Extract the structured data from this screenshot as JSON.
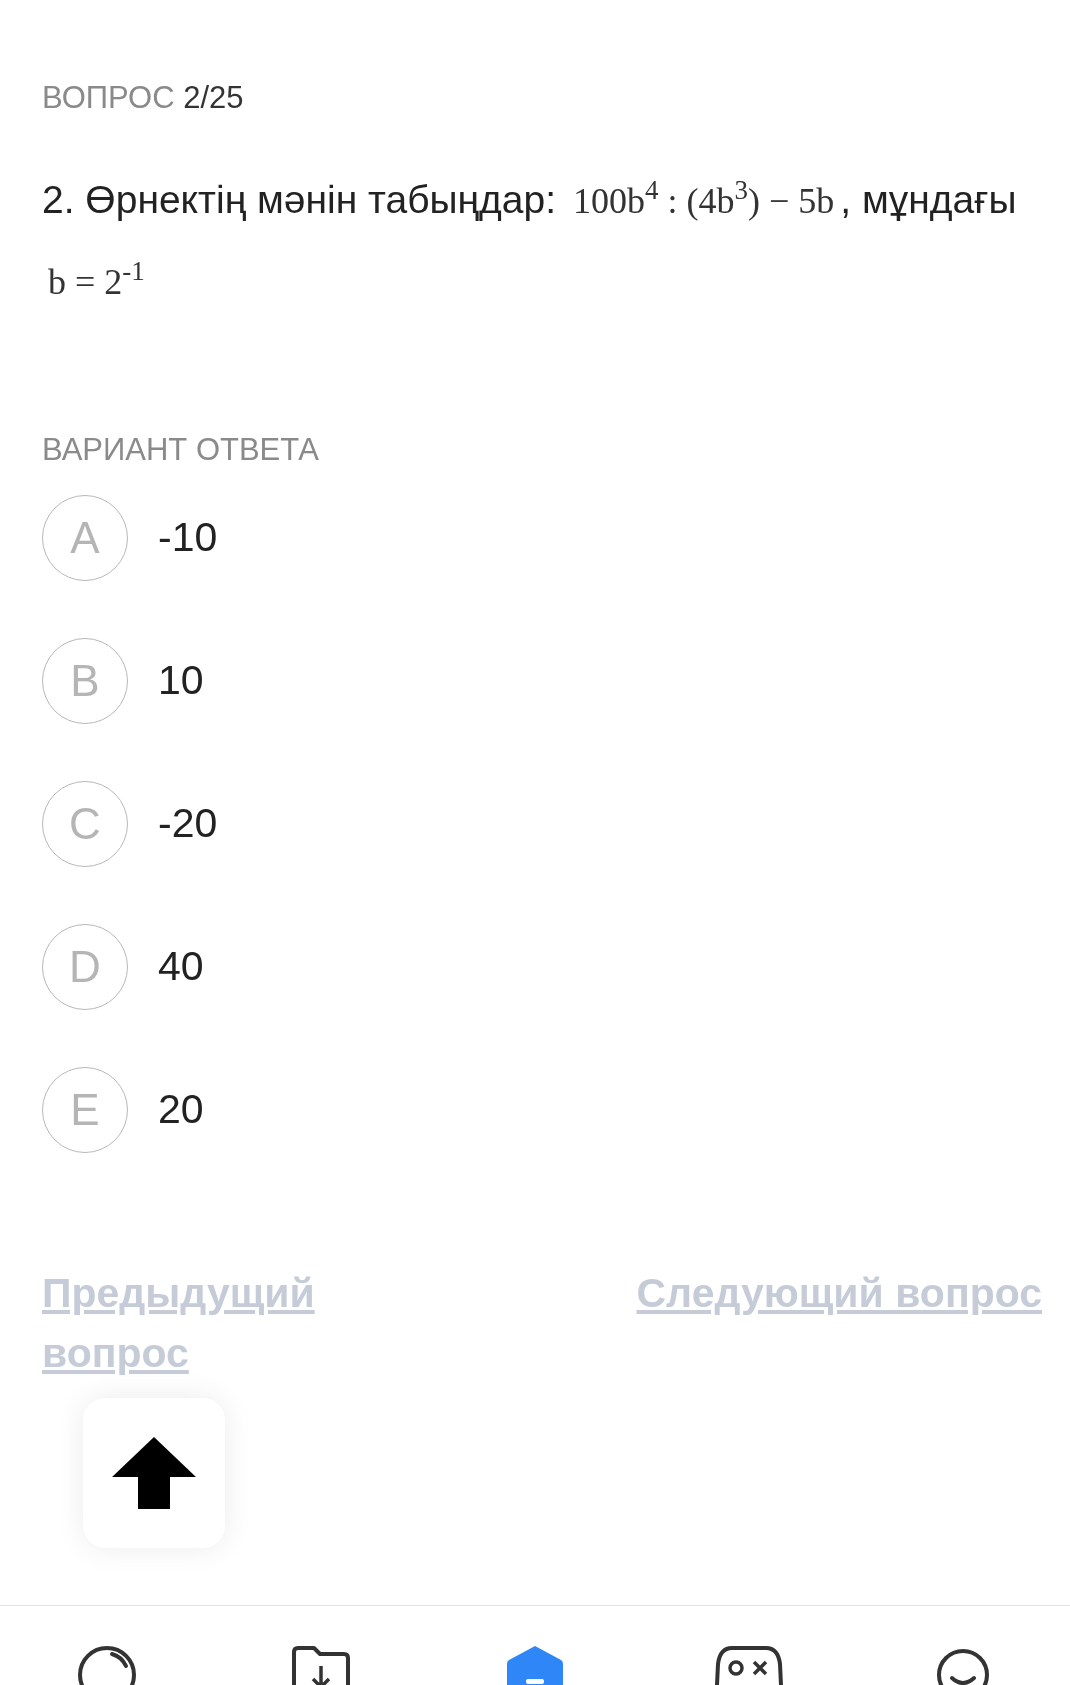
{
  "header": {
    "label": "ВОПРОС",
    "counter": "2/25"
  },
  "question": {
    "text_1": "2. Өрнектің мәнін табыңдар:",
    "formula_1": "100b$^{4}$ : (4b$^{3}$) − 5b",
    "text_2": ", мұндағы",
    "formula_2": "b = 2$^{-1}$"
  },
  "answers_label": "ВАРИАНТ ОТВЕТА",
  "options": [
    {
      "letter": "A",
      "text": "-10",
      "selected": false
    },
    {
      "letter": "B",
      "text": "10",
      "selected": false
    },
    {
      "letter": "C",
      "text": "-20",
      "selected": false
    },
    {
      "letter": "D",
      "text": "40",
      "selected": false
    },
    {
      "letter": "E",
      "text": "20",
      "selected": false
    }
  ],
  "nav": {
    "previous": "Предыдущий вопрос",
    "next": "Следующий вопрос"
  },
  "tab_bar": [
    {
      "kind": "circle",
      "selected": false
    },
    {
      "kind": "folder",
      "selected": false
    },
    {
      "kind": "home",
      "selected": true
    },
    {
      "kind": "gamepad",
      "selected": false
    },
    {
      "kind": "smile",
      "selected": false
    }
  ]
}
